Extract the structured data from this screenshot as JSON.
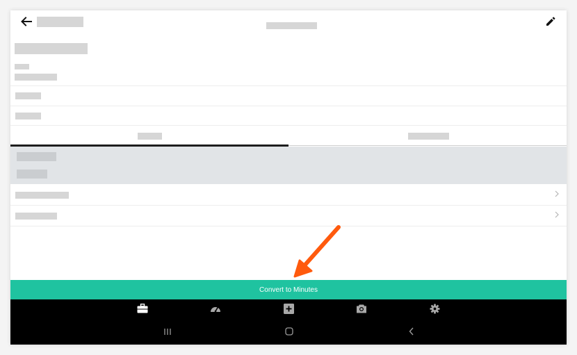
{
  "action_bar": {
    "back_icon": "arrow-left-icon",
    "edit_icon": "pencil-icon"
  },
  "colors": {
    "accent": "#1fc3a0",
    "tab_indicator": "#1d1d1d",
    "panel": "#e1e4e7",
    "placeholder": "#d6d6d6",
    "nav_background": "#000000",
    "annotation_arrow": "#ff5a0d"
  },
  "tabs": [
    {
      "selected": true
    },
    {
      "selected": false
    }
  ],
  "primary_action": {
    "label": "Convert to Minutes"
  },
  "bottom_nav": {
    "items": [
      {
        "icon": "briefcase-icon"
      },
      {
        "icon": "speedometer-icon"
      },
      {
        "icon": "plus-square-icon"
      },
      {
        "icon": "camera-icon"
      },
      {
        "icon": "gear-icon"
      }
    ]
  },
  "system_nav": {
    "items": [
      {
        "icon": "recents-icon"
      },
      {
        "icon": "home-icon"
      },
      {
        "icon": "back-chevron-icon"
      }
    ]
  },
  "annotation": {
    "type": "arrow",
    "points_to": "primary-action-button"
  }
}
